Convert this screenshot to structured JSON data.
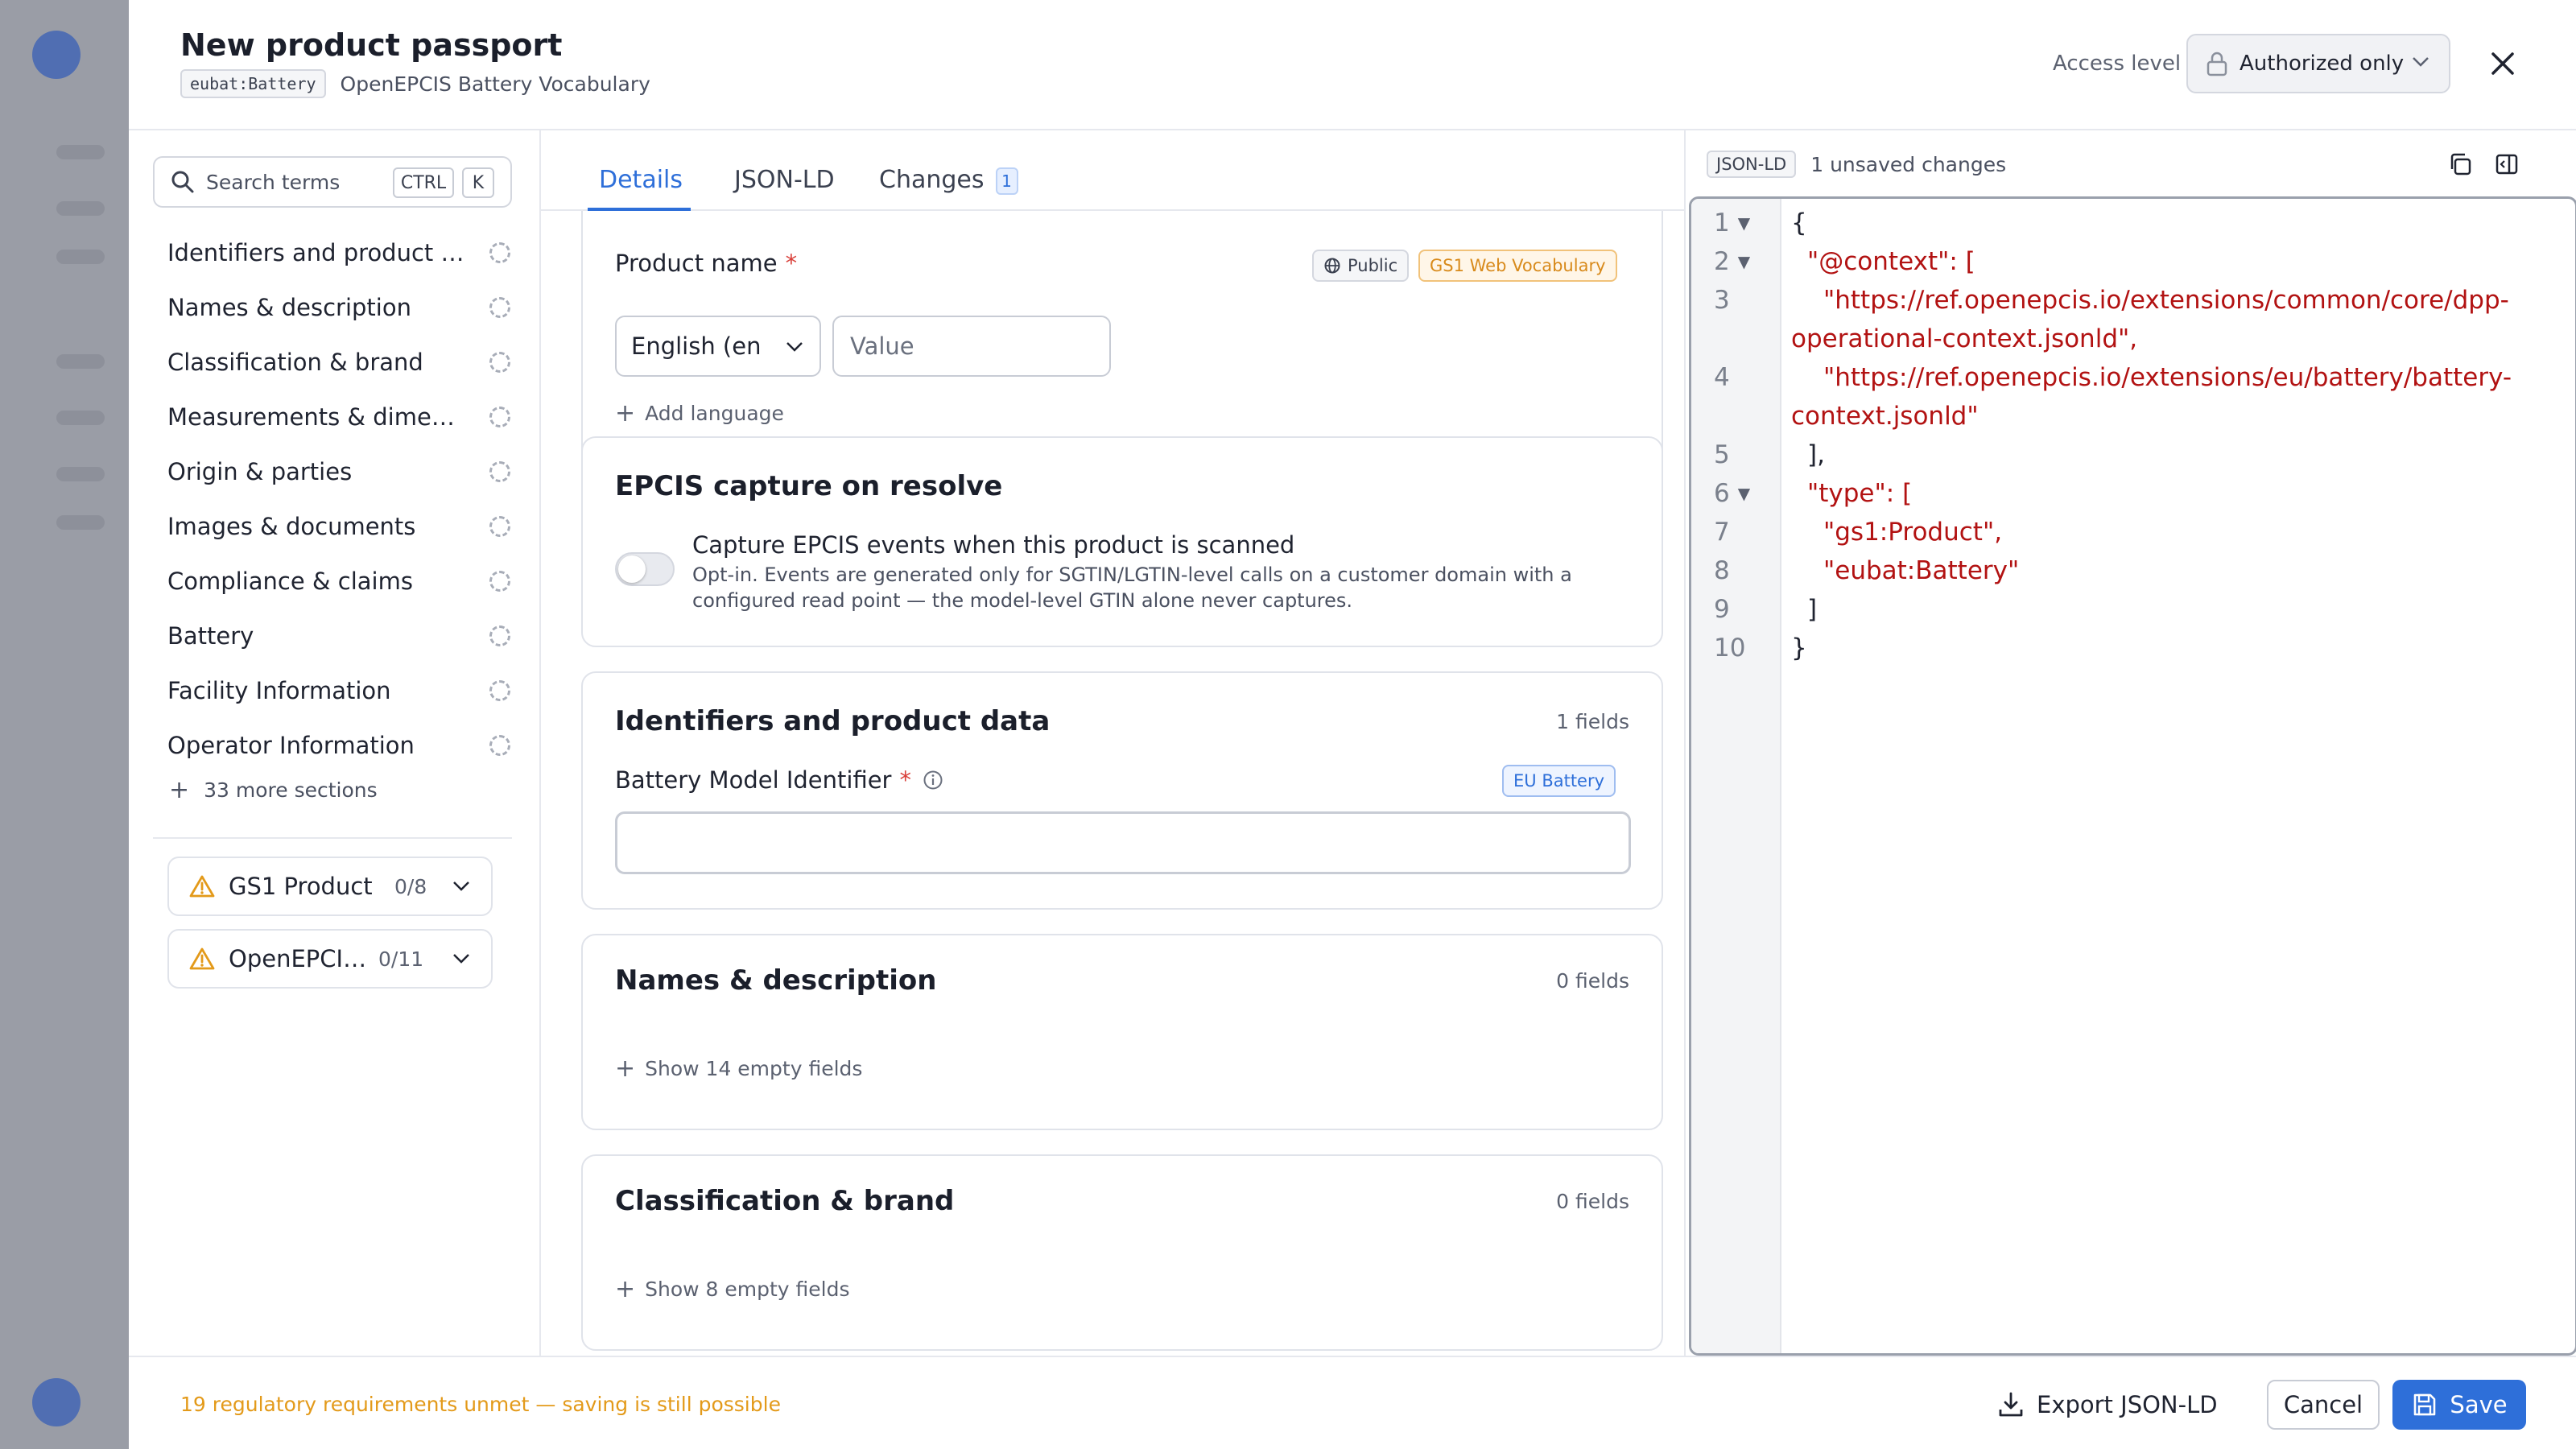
{
  "header": {
    "title": "New product passport",
    "type_chip": "eubat:Battery",
    "vocabulary_name": "OpenEPCIS Battery Vocabulary",
    "access_label": "Access level",
    "access_value": "Authorized only"
  },
  "sidebar": {
    "search_placeholder": "Search terms",
    "shortcut_keys": [
      "CTRL",
      "K"
    ],
    "items": [
      {
        "label": "Identifiers and product data"
      },
      {
        "label": "Names & description"
      },
      {
        "label": "Classification & brand"
      },
      {
        "label": "Measurements & dimensions"
      },
      {
        "label": "Origin & parties"
      },
      {
        "label": "Images & documents"
      },
      {
        "label": "Compliance & claims"
      },
      {
        "label": "Battery"
      },
      {
        "label": "Facility Information"
      },
      {
        "label": "Operator Information"
      }
    ],
    "more_sections": "33 more sections",
    "vocabularies": [
      {
        "name": "GS1 Product",
        "count": "0/8"
      },
      {
        "name": "OpenEPCIS Battery",
        "count": "0/11"
      }
    ]
  },
  "tabs": [
    {
      "label": "Details",
      "active": true
    },
    {
      "label": "JSON-LD",
      "active": false
    },
    {
      "label": "Changes",
      "active": false,
      "badge": "1"
    }
  ],
  "form": {
    "product_name": {
      "label": "Product name",
      "required_mark": "*",
      "visibility": "Public",
      "source": "GS1 Web Vocabulary",
      "language": "English (en",
      "value_placeholder": "Value",
      "add_language": "Add language"
    },
    "epcis": {
      "title": "EPCIS capture on resolve",
      "toggle_label": "Capture EPCIS events when this product is scanned",
      "toggle_description": "Opt-in. Events are generated only for SGTIN/LGTIN-level calls on a customer domain with a configured read point — the model-level GTIN alone never captures.",
      "enabled": false
    },
    "identifiers": {
      "title": "Identifiers and product data",
      "count": "1 fields",
      "field_label": "Battery Model Identifier",
      "required_mark": "*",
      "source": "EU Battery",
      "value": ""
    },
    "names": {
      "title": "Names & description",
      "count": "0 fields",
      "show_empty": "Show 14 empty fields"
    },
    "classification": {
      "title": "Classification & brand",
      "count": "0 fields",
      "show_empty": "Show 8 empty fields"
    }
  },
  "json_panel": {
    "format_chip": "JSON-LD",
    "unsaved": "1 unsaved changes",
    "line_numbers": [
      "1",
      "2",
      "3",
      "4",
      "5",
      "6",
      "7",
      "8",
      "9",
      "10"
    ],
    "lines": [
      "{",
      "\"@context\": [",
      "\"https://ref.openepcis.io/extensions/common/core/dpp-",
      "operational-context.jsonld\",",
      "\"https://ref.openepcis.io/extensions/eu/battery/battery-",
      "context.jsonld\"",
      "],",
      "\"type\": [",
      "\"gs1:Product\",",
      "\"eubat:Battery\"",
      "]",
      "}"
    ]
  },
  "footer": {
    "warning": "19 regulatory requirements unmet — saving is still possible",
    "export_label": "Export JSON-LD",
    "cancel_label": "Cancel",
    "save_label": "Save"
  },
  "colors": {
    "accent": "#2e6fd9",
    "warning": "#e39a1a",
    "json_string": "#b21212"
  }
}
